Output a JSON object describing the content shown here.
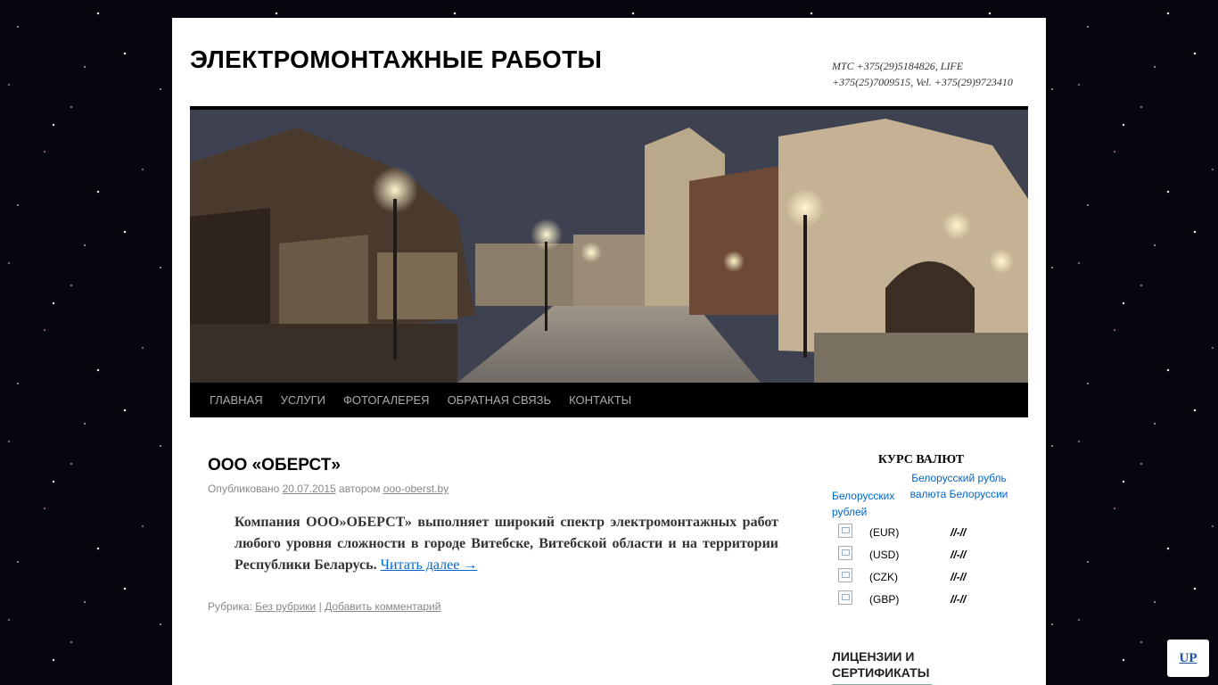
{
  "header": {
    "site_title": "ЭЛЕКТРОМОНТАЖНЫЕ РАБОТЫ",
    "site_description": "МТС +375(29)5184826, LIFE +375(25)7009515, Vel. +375(29)9723410"
  },
  "menu": {
    "items": [
      "ГЛАВНАЯ",
      "УСЛУГИ",
      "ФОТОГАЛЕРЕЯ",
      "ОБРАТНАЯ СВЯЗЬ",
      "КОНТАКТЫ"
    ]
  },
  "post": {
    "title": "ООО «ОБЕРСТ»",
    "published_label": "Опубликовано",
    "date": "20.07.2015",
    "author_label": "автором",
    "author": "ooo-oberst.by",
    "summary": "Компания ООО»ОБЕРСТ» выполняет широкий спектр электромонтажных работ любого уровня сложности в городе Витебске, Витебской области  и на территории Республики Беларусь.",
    "read_more": "Читать далее →",
    "category_label": "Рубрика:",
    "category": "Без рубрики",
    "separator": "|",
    "comment_link": "Добавить комментарий"
  },
  "sidebar": {
    "currency_title": "КУРС ВАЛЮТ",
    "currency_logo_alt": "Белорусский рубль валюта Белоруссии",
    "currency_units": "Белорусских рублей",
    "rates": [
      {
        "code": "(EUR)",
        "value": "//-//"
      },
      {
        "code": "(USD)",
        "value": "//-//"
      },
      {
        "code": "(CZK)",
        "value": "//-//"
      },
      {
        "code": "(GBP)",
        "value": "//-//"
      }
    ],
    "licenses_title": "ЛИЦЕНЗИИ И СЕРТИФИКАТЫ"
  },
  "up_button": "UP"
}
